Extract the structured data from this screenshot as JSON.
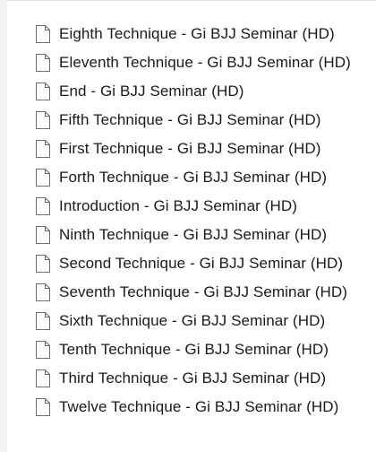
{
  "files": [
    {
      "name": "Eighth Technique - Gi BJJ Seminar (HD)",
      "icon": "document-icon"
    },
    {
      "name": "Eleventh Technique - Gi BJJ Seminar (HD)",
      "icon": "document-icon"
    },
    {
      "name": "End - Gi BJJ Seminar (HD)",
      "icon": "document-icon"
    },
    {
      "name": "Fifth Technique - Gi BJJ Seminar (HD)",
      "icon": "document-icon"
    },
    {
      "name": "First Technique - Gi BJJ Seminar (HD)",
      "icon": "document-icon"
    },
    {
      "name": "Forth Technique - Gi BJJ Seminar (HD)",
      "icon": "document-icon"
    },
    {
      "name": "Introduction - Gi BJJ Seminar (HD)",
      "icon": "document-icon"
    },
    {
      "name": "Ninth Technique - Gi BJJ Seminar (HD)",
      "icon": "document-icon"
    },
    {
      "name": "Second Technique - Gi BJJ Seminar (HD)",
      "icon": "document-icon"
    },
    {
      "name": "Seventh Technique - Gi BJJ Seminar (HD)",
      "icon": "document-icon"
    },
    {
      "name": "Sixth Technique - Gi BJJ Seminar (HD)",
      "icon": "document-icon"
    },
    {
      "name": "Tenth Technique - Gi BJJ Seminar (HD)",
      "icon": "document-icon"
    },
    {
      "name": "Third Technique - Gi BJJ Seminar (HD)",
      "icon": "document-icon"
    },
    {
      "name": "Twelve Technique - Gi BJJ Seminar (HD)",
      "icon": "document-icon"
    }
  ],
  "colors": {
    "text": "#1a1a1a",
    "background": "#ffffff",
    "icon_stroke": "#6b6b6b"
  }
}
